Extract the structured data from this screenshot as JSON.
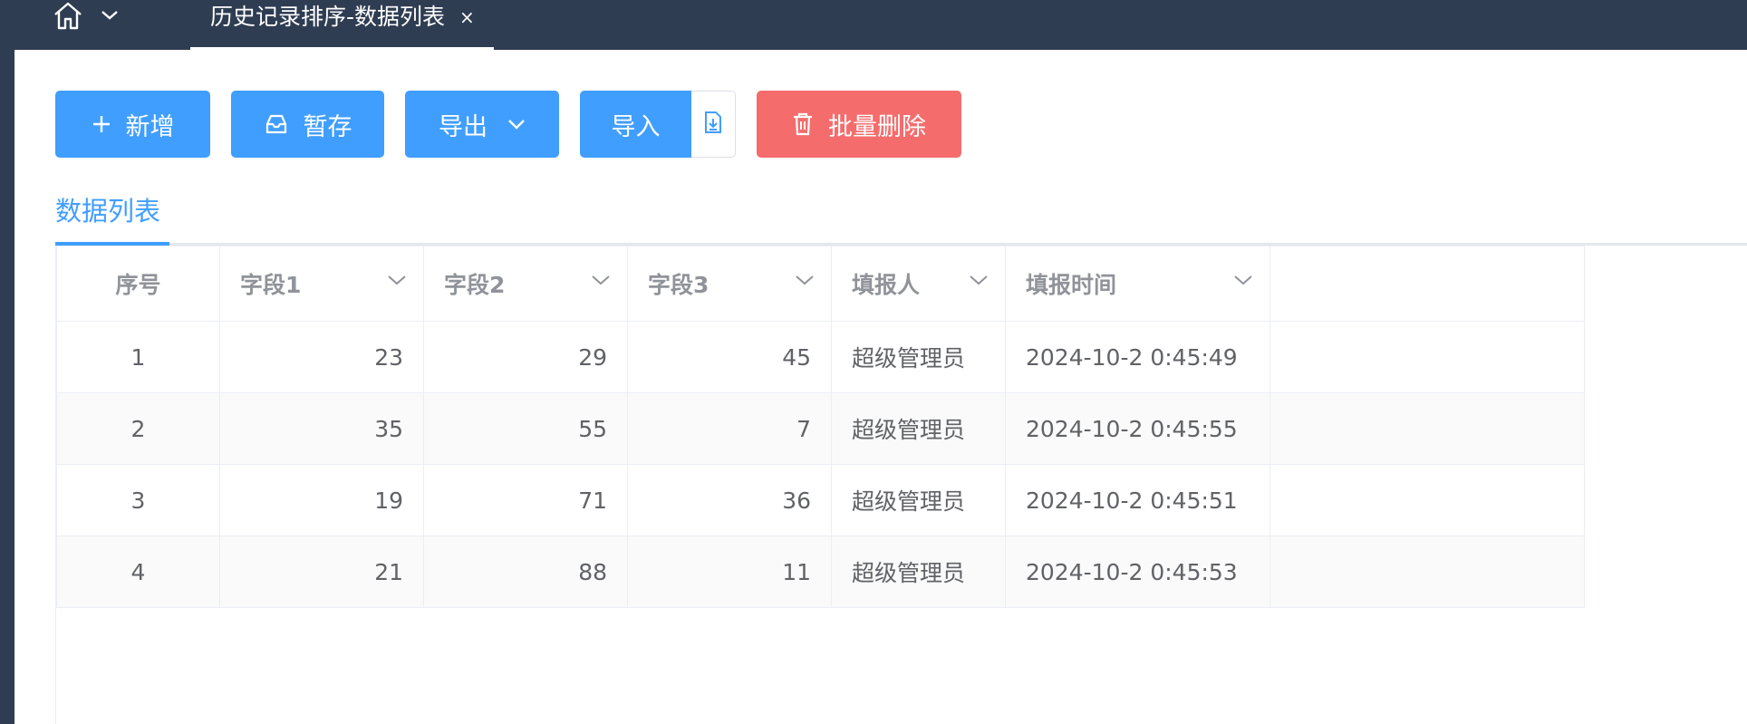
{
  "topbar": {
    "home_icon": "home-icon",
    "dropdown_icon": "chevron-down-icon",
    "active_tab": {
      "label": "历史记录排序-数据列表",
      "close": "×"
    }
  },
  "toolbar": {
    "add_label": "新增",
    "save_label": "暂存",
    "export_label": "导出",
    "import_label": "导入",
    "delete_label": "批量删除"
  },
  "section_tab": {
    "label": "数据列表"
  },
  "table": {
    "columns": [
      "序号",
      "字段1",
      "字段2",
      "字段3",
      "填报人",
      "填报时间"
    ],
    "rows": [
      {
        "index": "1",
        "f1": "23",
        "f2": "29",
        "f3": "45",
        "user": "超级管理员",
        "time": "2024-10-2 0:45:49"
      },
      {
        "index": "2",
        "f1": "35",
        "f2": "55",
        "f3": "7",
        "user": "超级管理员",
        "time": "2024-10-2 0:45:55"
      },
      {
        "index": "3",
        "f1": "19",
        "f2": "71",
        "f3": "36",
        "user": "超级管理员",
        "time": "2024-10-2 0:45:51"
      },
      {
        "index": "4",
        "f1": "21",
        "f2": "88",
        "f3": "11",
        "user": "超级管理员",
        "time": "2024-10-2 0:45:53"
      }
    ]
  },
  "colors": {
    "topbar": "#2f3d52",
    "primary": "#409eff",
    "danger": "#f56c6c"
  }
}
